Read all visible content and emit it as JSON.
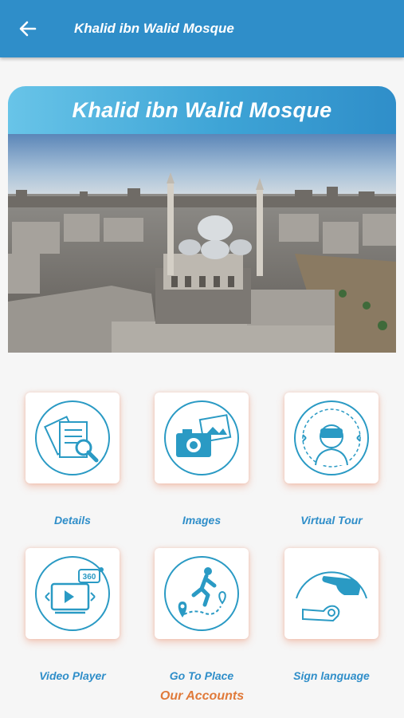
{
  "appbar": {
    "title": "Khalid ibn Walid Mosque",
    "back_icon": "arrow-left-icon"
  },
  "card": {
    "title": "Khalid ibn Walid Mosque"
  },
  "menu": [
    {
      "label": "Details",
      "icon": "document-search-icon"
    },
    {
      "label": "Images",
      "icon": "camera-icon"
    },
    {
      "label": "Virtual Tour",
      "icon": "vr-headset-icon"
    },
    {
      "label": "Video Player",
      "icon": "video-360-icon"
    },
    {
      "label": "Go To Place",
      "icon": "walking-route-icon"
    },
    {
      "label": "Sign language",
      "icon": "sign-language-icon"
    }
  ],
  "footer": {
    "accounts_label": "Our Accounts"
  },
  "colors": {
    "primary": "#2f8ec9",
    "accent": "#e07a3a",
    "icon": "#2a9ac4"
  }
}
